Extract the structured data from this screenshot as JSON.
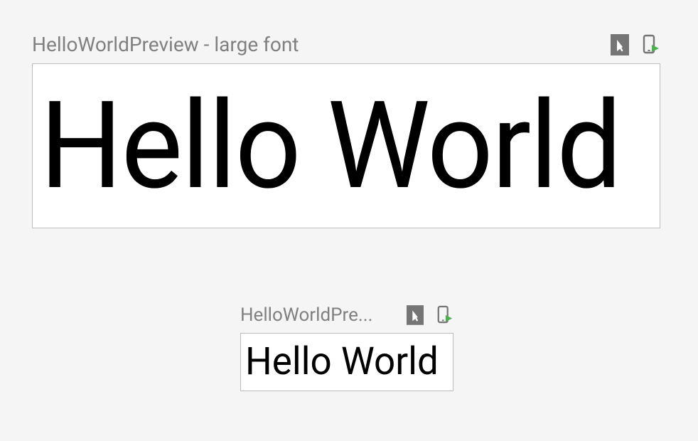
{
  "previews": {
    "large": {
      "title": "HelloWorldPreview - large font",
      "content": "Hello World"
    },
    "small": {
      "title": "HelloWorldPre...",
      "content": "Hello World"
    }
  }
}
